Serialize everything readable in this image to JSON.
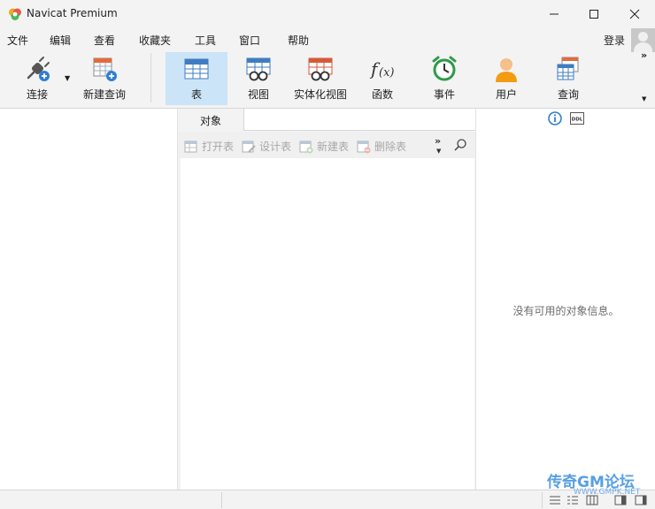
{
  "window": {
    "title": "Navicat Premium"
  },
  "menu": {
    "items": [
      "文件",
      "编辑",
      "查看",
      "收藏夹",
      "工具",
      "窗口",
      "帮助"
    ],
    "login": "登录"
  },
  "toolbar": {
    "connect": "连接",
    "new_query": "新建查询",
    "table": "表",
    "view": "视图",
    "mat_view": "实体化视图",
    "function": "函数",
    "event": "事件",
    "user": "用户",
    "query": "查询",
    "more": "»"
  },
  "objects": {
    "tab_label": "对象",
    "open_table": "打开表",
    "design_table": "设计表",
    "new_table": "新建表",
    "delete_table": "删除表",
    "more": "»"
  },
  "info_panel": {
    "empty_text": "没有可用的对象信息。",
    "ddl_label": "DDL"
  },
  "watermark": {
    "text": "传奇GM论坛",
    "sub": "WWW.GMPK.NET"
  },
  "colors": {
    "active_tab_bg": "#cce4f7",
    "accent": "#2f7fd0"
  }
}
